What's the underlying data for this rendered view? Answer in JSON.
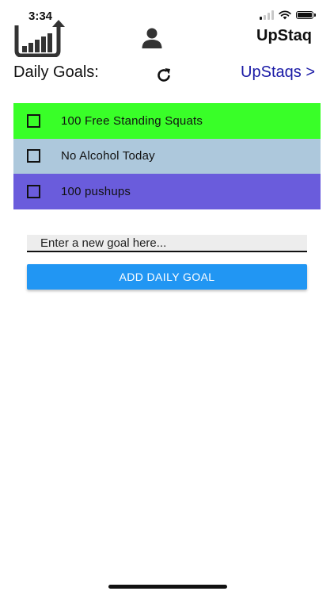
{
  "status_bar": {
    "time": "3:34"
  },
  "header": {
    "logo_icon": "upstaq-logo-icon",
    "profile_icon": "user-profile-icon",
    "app_title": "UpStaq"
  },
  "goals_header": {
    "label": "Daily Goals:",
    "refresh_icon": "refresh-icon",
    "link_label": "UpStaqs >"
  },
  "goals": [
    {
      "text": "100 Free Standing Squats",
      "color": "#39ff28",
      "checked": false
    },
    {
      "text": "No Alcohol Today",
      "color": "#adc8dc",
      "checked": false
    },
    {
      "text": "100 pushups",
      "color": "#6a5cdc",
      "checked": false
    }
  ],
  "new_goal": {
    "placeholder": "Enter a new goal here...",
    "value": "",
    "button_label": "ADD DAILY GOAL"
  },
  "colors": {
    "accent": "#2196f3",
    "link": "#1a1aa6"
  }
}
